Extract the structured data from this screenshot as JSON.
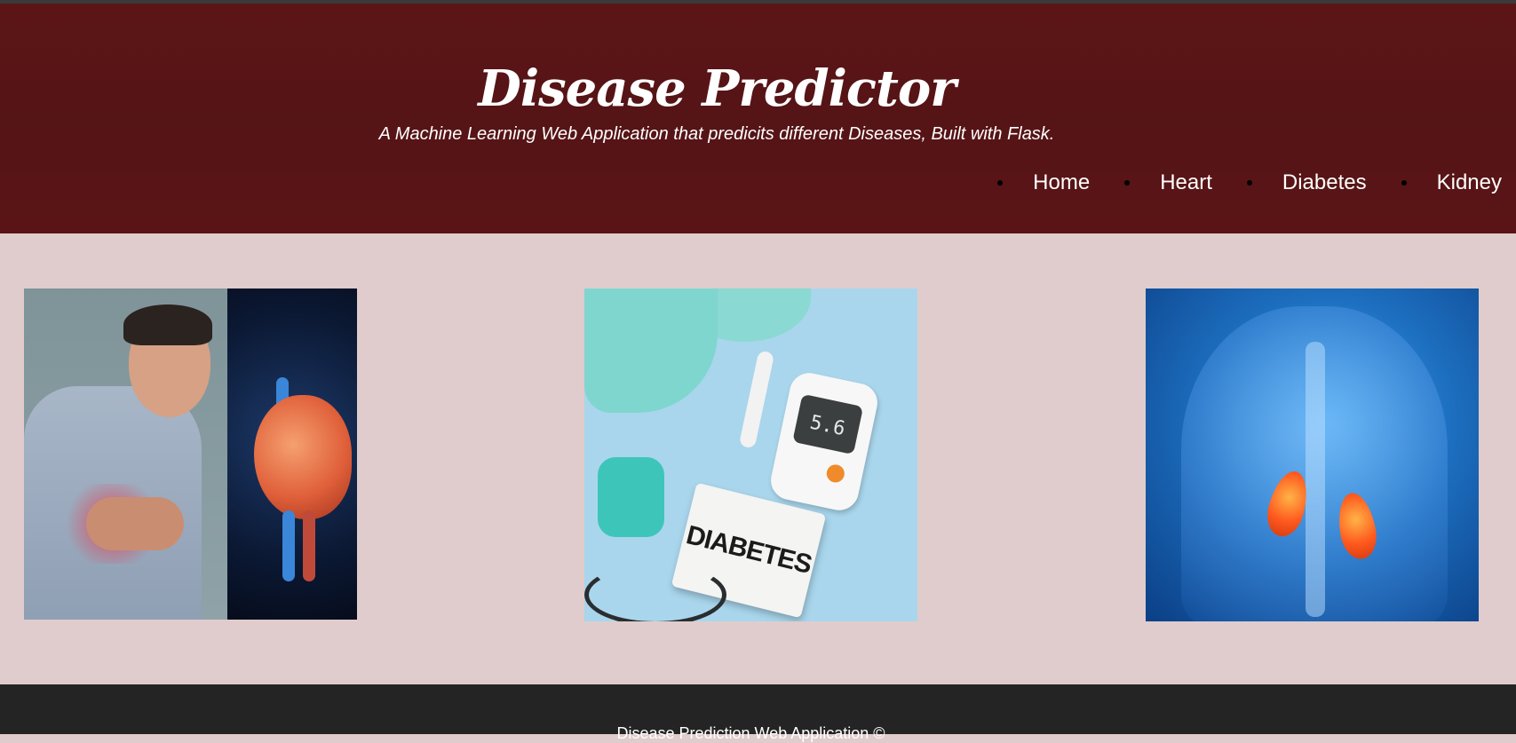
{
  "header": {
    "title": "Disease Predictor",
    "subtitle": "A Machine Learning Web Application that predicits different Diseases, Built with Flask."
  },
  "nav": {
    "items": [
      {
        "label": "Home"
      },
      {
        "label": "Heart"
      },
      {
        "label": "Diabetes"
      },
      {
        "label": "Kidney"
      }
    ]
  },
  "cards": {
    "heart": {
      "icon": "heart-attack-image"
    },
    "diabetes": {
      "icon": "diabetes-kit-image",
      "meter_reading": "5.6",
      "notebook_text": "DIABETES"
    },
    "kidney": {
      "icon": "kidney-anatomy-image"
    }
  },
  "footer": {
    "text": "Disease Prediction Web Application ©"
  },
  "colors": {
    "header_bg": "#5a1416",
    "main_bg": "#e0cccc",
    "footer_bg": "#242424",
    "nav_text": "#ffffff"
  }
}
